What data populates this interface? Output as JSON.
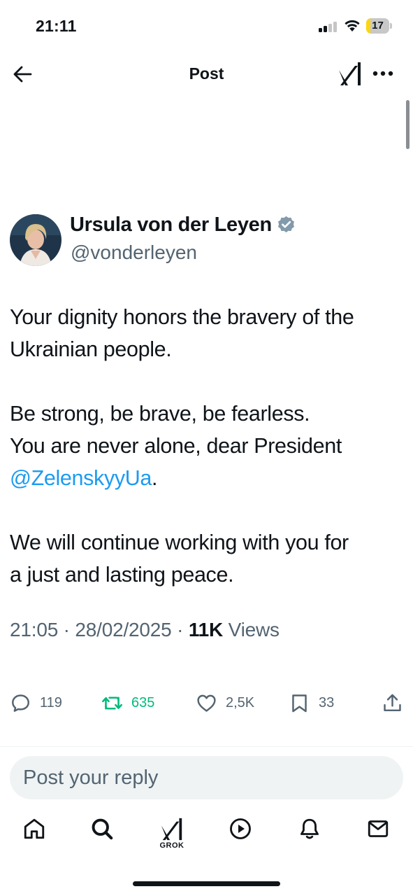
{
  "status_bar": {
    "time": "21:11",
    "battery_level": "17",
    "battery_color": "#ffd60a"
  },
  "header": {
    "title": "Post",
    "back_icon": "arrow-left-icon",
    "grok_icon": "grok-icon",
    "more_icon": "more-horizontal-icon"
  },
  "post": {
    "author": {
      "name": "Ursula von der Leyen",
      "handle": "@vonderleyen",
      "verified": true,
      "verified_color": "#829aab"
    },
    "text": {
      "line1": "Your dignity honors the bravery of the",
      "line2": "Ukrainian people.",
      "line3": "Be strong, be brave, be fearless.",
      "line4": "You are never alone, dear President",
      "mention": "@ZelenskyyUa",
      "mention_suffix": ".",
      "line6": "We will continue working with you for",
      "line7": "a just and lasting peace."
    },
    "meta": {
      "time": "21:05",
      "separator": "·",
      "date": "28/02/2025",
      "views_count": "11K",
      "views_label": "Views"
    },
    "actions": {
      "replies": "119",
      "reposts": "635",
      "likes": "2,5K",
      "bookmarks": "33"
    }
  },
  "reply": {
    "placeholder": "Post your reply"
  },
  "tabbar": {
    "grok_label": "GROK"
  },
  "colors": {
    "accent": "#1d9bf0",
    "repost": "#00ba7c",
    "secondary_text": "#536471"
  }
}
